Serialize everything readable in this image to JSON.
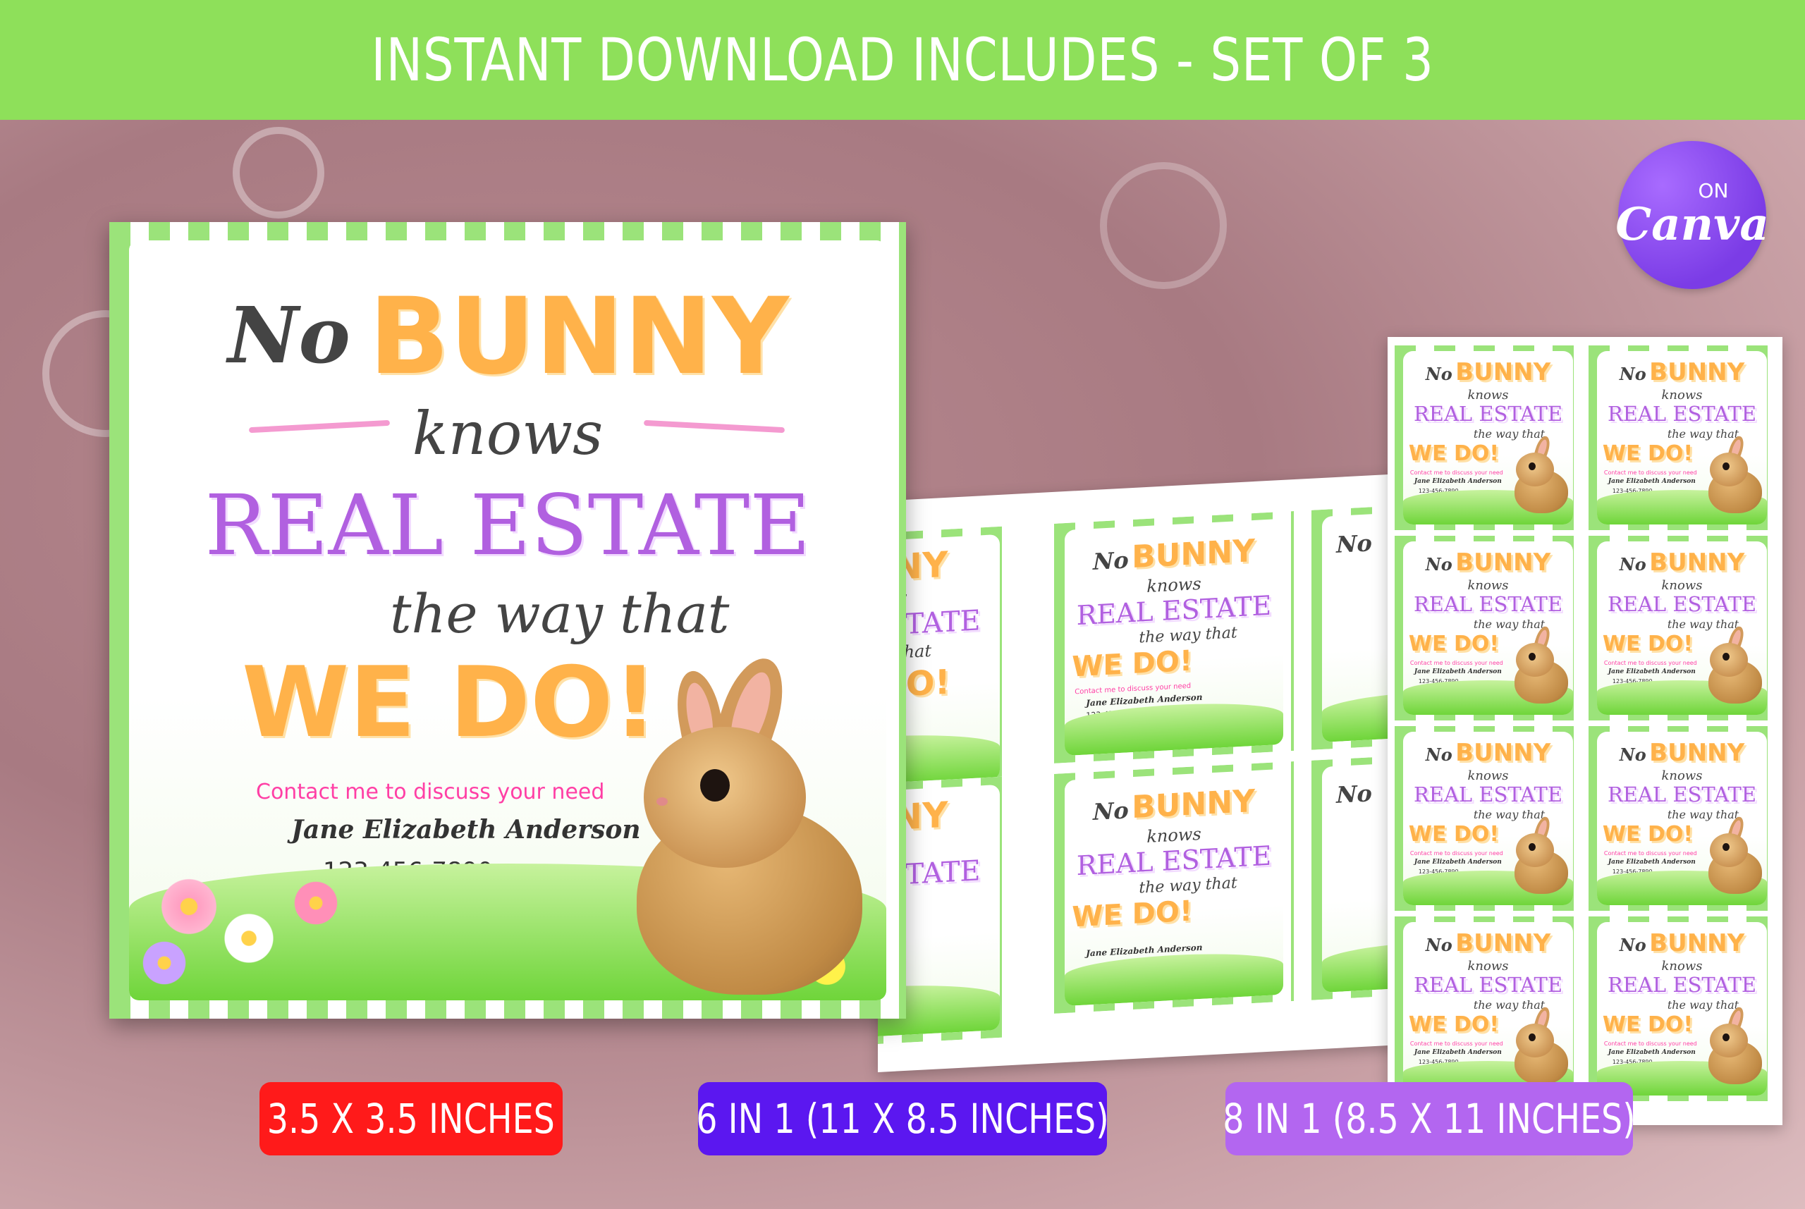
{
  "banner": {
    "text": "INSTANT DOWNLOAD INCLUDES -  SET OF 3"
  },
  "badge": {
    "on": "ON",
    "brand": "Canva"
  },
  "card": {
    "no": "No",
    "bunny": "BUNNY",
    "knows": "knows",
    "real_estate": "REAL ESTATE",
    "the_way_that": "the way that",
    "we_do": "WE DO!",
    "contact": "Contact me to discuss your need",
    "name": "Jane Elizabeth Anderson",
    "phone": "123-456-7890"
  },
  "sizes": [
    {
      "label": "3.5 X 3.5 INCHES",
      "color": "#ff1a1a"
    },
    {
      "label": "6 IN 1 (11 X 8.5 INCHES)",
      "color": "#5b17f0"
    },
    {
      "label": "8 IN 1 (8.5 X 11 INCHES)",
      "color": "#b366f0"
    }
  ],
  "colors": {
    "banner": "#8ee05a",
    "frame_green": "#9be37a",
    "orange": "#ffb24a",
    "purple": "#b160e0",
    "pink": "#ff3fa5"
  }
}
